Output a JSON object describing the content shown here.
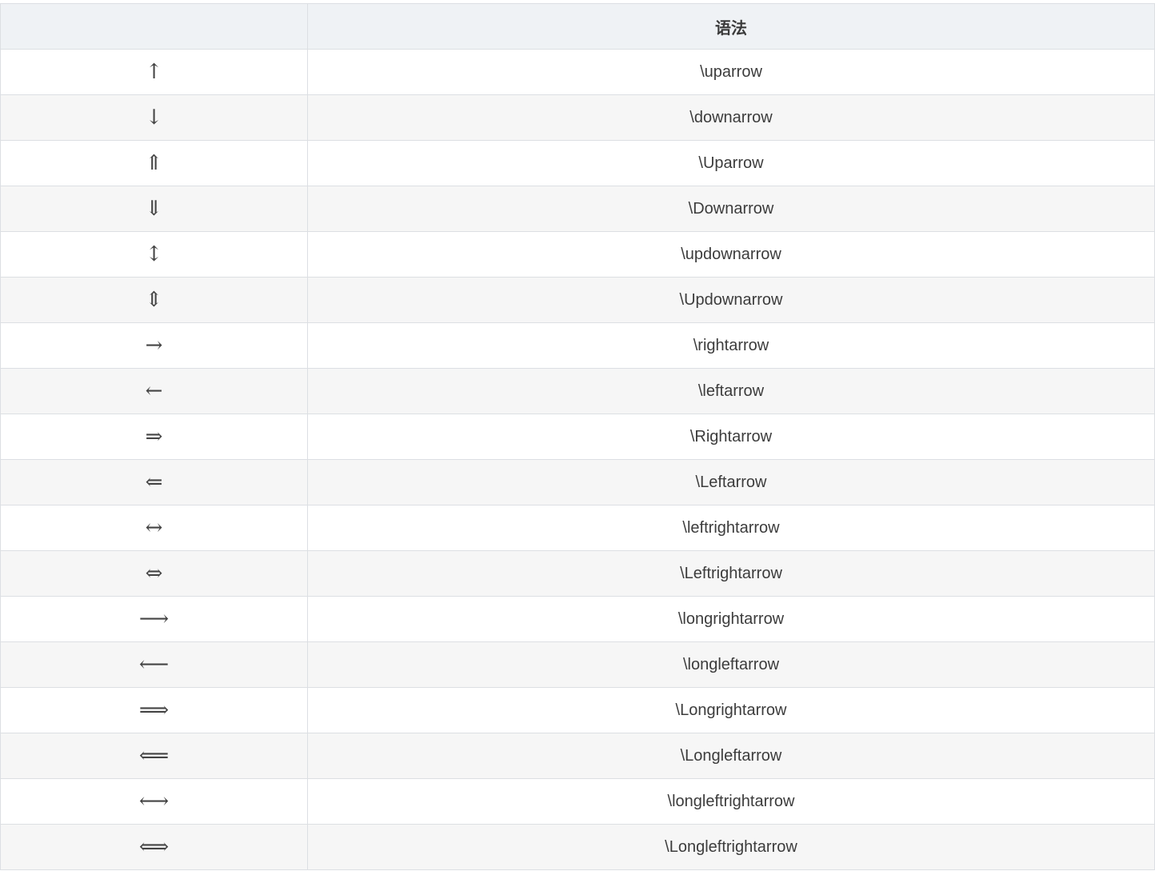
{
  "table": {
    "headers": [
      "",
      "语法"
    ],
    "rows": [
      {
        "symbol": "↑",
        "syntax": "\\uparrow"
      },
      {
        "symbol": "↓",
        "syntax": "\\downarrow"
      },
      {
        "symbol": "⇑",
        "syntax": "\\Uparrow"
      },
      {
        "symbol": "⇓",
        "syntax": "\\Downarrow"
      },
      {
        "symbol": "↕",
        "syntax": "\\updownarrow"
      },
      {
        "symbol": "⇕",
        "syntax": "\\Updownarrow"
      },
      {
        "symbol": "→",
        "syntax": "\\rightarrow"
      },
      {
        "symbol": "←",
        "syntax": "\\leftarrow"
      },
      {
        "symbol": "⇒",
        "syntax": "\\Rightarrow"
      },
      {
        "symbol": "⇐",
        "syntax": "\\Leftarrow"
      },
      {
        "symbol": "↔",
        "syntax": "\\leftrightarrow"
      },
      {
        "symbol": "⇔",
        "syntax": "\\Leftrightarrow"
      },
      {
        "symbol": "⟶",
        "syntax": "\\longrightarrow"
      },
      {
        "symbol": "⟵",
        "syntax": "\\longleftarrow"
      },
      {
        "symbol": "⟹",
        "syntax": "\\Longrightarrow"
      },
      {
        "symbol": "⟸",
        "syntax": "\\Longleftarrow"
      },
      {
        "symbol": "⟷",
        "syntax": "\\longleftrightarrow"
      },
      {
        "symbol": "⟺",
        "syntax": "\\Longleftrightarrow"
      }
    ]
  }
}
